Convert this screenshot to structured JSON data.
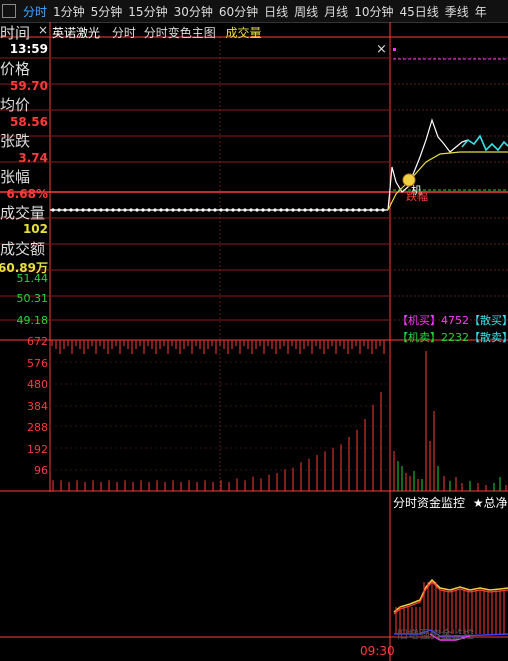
{
  "tabs": [
    "分时",
    "1分钟",
    "5分钟",
    "15分钟",
    "30分钟",
    "60分钟",
    "日线",
    "周线",
    "月线",
    "10分钟",
    "45日线",
    "季线",
    "年"
  ],
  "active_tab": "分时",
  "title": {
    "stock": "英诺激光",
    "mode": "分时",
    "variant": "分时变色主图",
    "volume_label": "成交量"
  },
  "close_icon": "×",
  "info": {
    "time_label": "时间",
    "time_value": "13:59",
    "price_label": "价格",
    "price_value": "59.70",
    "avg_label": "均价",
    "avg_value": "58.56",
    "change_label": "张跌",
    "change_value": "3.74",
    "pct_label": "张幅",
    "pct_value": "6.68%",
    "vol_label": "成交量",
    "vol_value": "102",
    "amount_label": "成交额",
    "amount_value": "60.89万"
  },
  "price_axis": [
    "51.44",
    "50.31",
    "49.18"
  ],
  "volume_axis": [
    "672",
    "576",
    "480",
    "384",
    "288",
    "192",
    "96"
  ],
  "buy_lines": [
    {
      "a": "【机买】4752",
      "b": "【散买】"
    },
    {
      "a": "【机卖】2232",
      "b": "【散卖】"
    }
  ],
  "marker_text": "机",
  "marker_text2": "跌幅",
  "fund_panel": {
    "label": "分时资金监控",
    "net_label": "★总净:"
  },
  "bottom_watermark": "旧增强资金监控",
  "time_axis": "09:30",
  "colors": {
    "up": "#ff3b3b",
    "down": "#21d83a",
    "avg": "#e6e040",
    "price": "#ffffff",
    "cyan": "#36e0e8",
    "magenta": "#ff38ff"
  }
}
